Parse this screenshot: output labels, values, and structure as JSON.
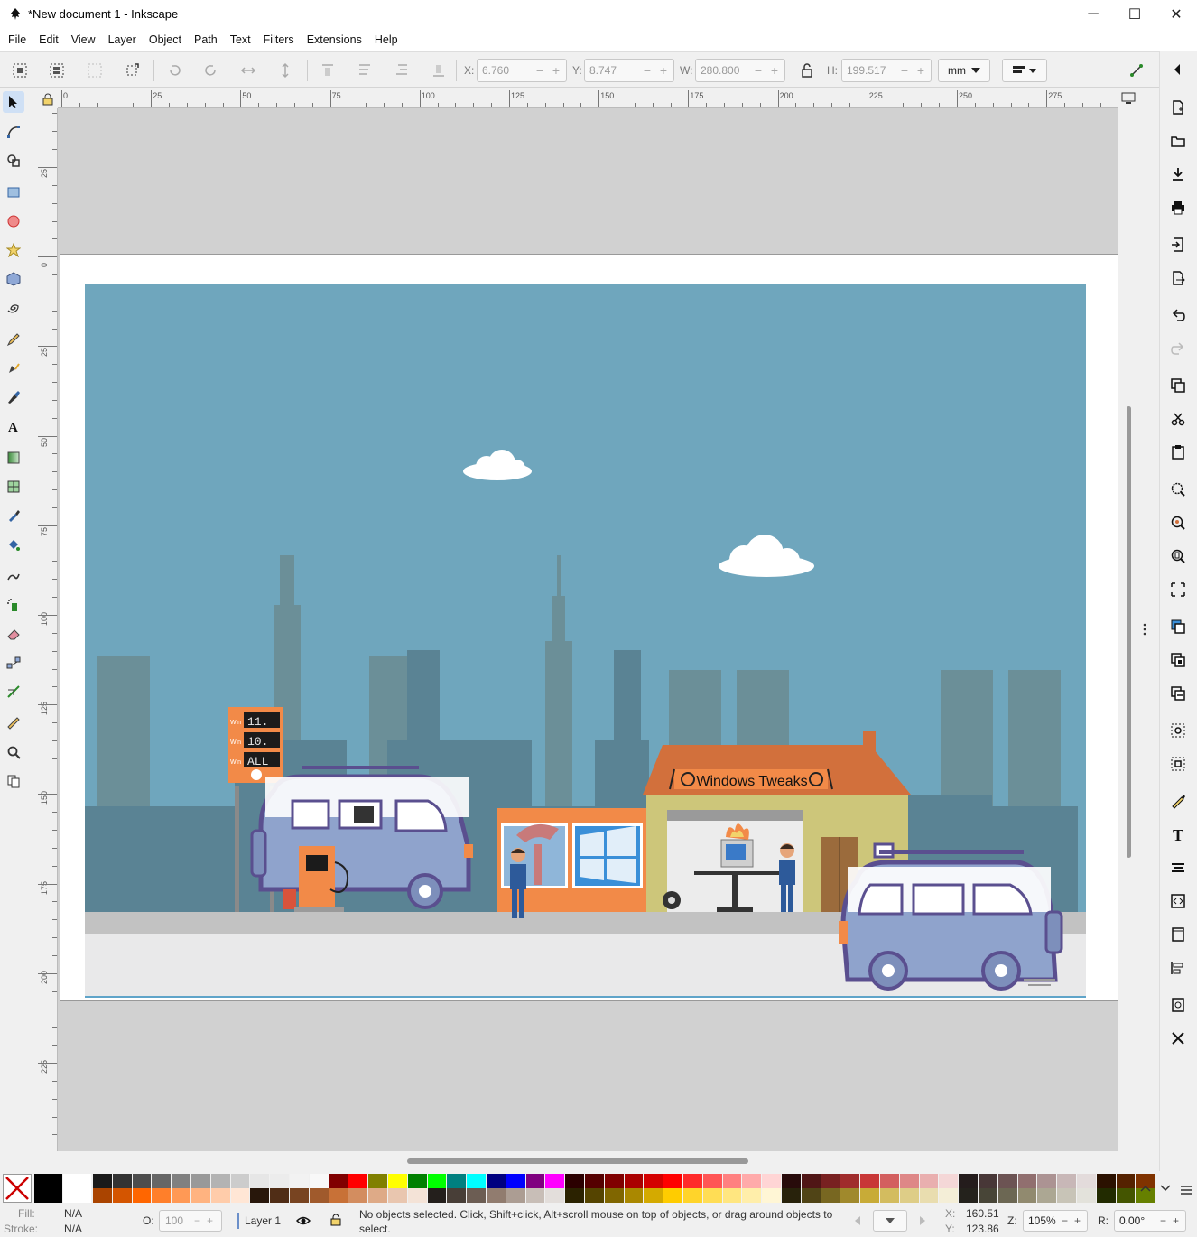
{
  "window": {
    "title": "*New document 1 - Inkscape",
    "minimize": "─",
    "maximize": "☐",
    "close": "✕"
  },
  "menu": [
    "File",
    "Edit",
    "View",
    "Layer",
    "Object",
    "Path",
    "Text",
    "Filters",
    "Extensions",
    "Help"
  ],
  "toolbar": {
    "x_label": "X:",
    "x_value": "6.760",
    "y_label": "Y:",
    "y_value": "8.747",
    "w_label": "W:",
    "w_value": "280.800",
    "h_label": "H:",
    "h_value": "199.517",
    "minus": "−",
    "plus": "+",
    "unit": "mm"
  },
  "ruler": {
    "h_labels": [
      "0",
      "25",
      "50",
      "75",
      "100",
      "125",
      "150",
      "175",
      "200",
      "225",
      "250",
      "275"
    ],
    "v_labels": [
      "25",
      "0",
      "25",
      "50",
      "75",
      "100",
      "125",
      "150",
      "175",
      "200",
      "225"
    ]
  },
  "artwork": {
    "sign_text": "Windows Tweaks",
    "price_rows": [
      "Win",
      "Win",
      "Win"
    ],
    "price_digits": [
      "11.",
      "10.",
      "ALL"
    ],
    "sky_color": "#6fa6bd",
    "roof_color": "#d2703c"
  },
  "status": {
    "fill_label": "Fill:",
    "fill_value": "N/A",
    "stroke_label": "Stroke:",
    "stroke_value": "N/A",
    "opacity_label": "O:",
    "opacity_value": "100",
    "layer": "Layer 1",
    "message": "No objects selected. Click, Shift+click, Alt+scroll mouse on top of objects, or drag around objects to select.",
    "x_label": "X:",
    "x_value": "160.51",
    "y_label": "Y:",
    "y_value": "123.86",
    "zoom_label": "Z:",
    "zoom_value": "105%",
    "rotate_label": "R:",
    "rotate_value": "0.00°"
  },
  "palette": {
    "row1": [
      "#000000",
      "#ffffff",
      "#1a1a1a",
      "#333333",
      "#4d4d4d",
      "#666666",
      "#808080",
      "#999999",
      "#b3b3b3",
      "#cccccc",
      "#e6e6e6",
      "#ececec",
      "#f2f2f2",
      "#f8f8f8",
      "#800000",
      "#ff0000",
      "#808000",
      "#ffff00",
      "#008000",
      "#00ff00",
      "#008080",
      "#00ffff",
      "#000080",
      "#0000ff",
      "#800080",
      "#ff00ff",
      "#2b0000",
      "#550000",
      "#800000",
      "#aa0000",
      "#d40000",
      "#ff0000",
      "#ff2a2a",
      "#ff5555",
      "#ff8080",
      "#ffaaaa",
      "#ffd5d5",
      "#280b0b",
      "#501616",
      "#782121",
      "#a02c2c",
      "#c83737",
      "#d35f5f",
      "#de8787",
      "#e9afaf",
      "#f4d7d7",
      "#241c1c",
      "#483737",
      "#6c5353",
      "#916f6f",
      "#ac9393",
      "#c8b7b7",
      "#e3dbdb",
      "#2b1100",
      "#552200",
      "#803300"
    ],
    "row2": [
      "#aa4400",
      "#d45500",
      "#ff6600",
      "#ff7f2a",
      "#ff9955",
      "#ffb380",
      "#ffccaa",
      "#ffe6d5",
      "#28170b",
      "#502d16",
      "#784421",
      "#a05a2c",
      "#c87137",
      "#d38d5f",
      "#deaa87",
      "#e9c6af",
      "#f4e3d7",
      "#241f1c",
      "#483e37",
      "#6c5d53",
      "#917c6f",
      "#ac9d93",
      "#c8beb7",
      "#e3dedb",
      "#2b2200",
      "#554400",
      "#806600",
      "#aa8800",
      "#d4aa00",
      "#ffcc00",
      "#ffd42a",
      "#ffdd55",
      "#ffe680",
      "#ffeeaa",
      "#fff6d5",
      "#28220b",
      "#504416",
      "#786721",
      "#a0892c",
      "#c8ab37",
      "#d3bc5f",
      "#decd87",
      "#e9ddaf",
      "#f4eed7",
      "#24221c",
      "#484537",
      "#6c6753",
      "#918a6f",
      "#aca793",
      "#c8c4b7",
      "#e3e2db",
      "#222b00",
      "#445500",
      "#668000"
    ]
  }
}
